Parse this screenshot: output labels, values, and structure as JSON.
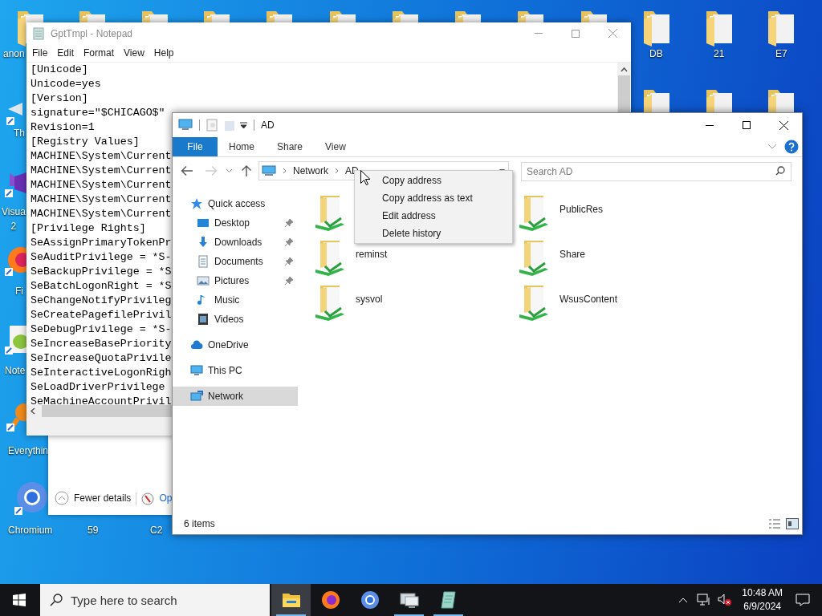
{
  "desktop": {
    "icons": [
      {
        "kind": "folder",
        "label": "anon"
      },
      {
        "kind": "folder"
      },
      {
        "kind": "folder"
      },
      {
        "kind": "folder"
      },
      {
        "kind": "folder"
      },
      {
        "kind": "folder"
      },
      {
        "kind": "folder"
      },
      {
        "kind": "folder"
      },
      {
        "kind": "folder"
      },
      {
        "kind": "folder"
      },
      {
        "kind": "folder",
        "label": "DB"
      },
      {
        "kind": "folder",
        "label": "21"
      },
      {
        "kind": "folder",
        "label": "E7"
      },
      {
        "kind": "folder"
      },
      {
        "kind": "folder"
      },
      {
        "kind": "folder"
      },
      {
        "kind": "app",
        "label": "Th"
      },
      {
        "kind": "visualstudio",
        "label": "Visua\n2"
      },
      {
        "kind": "firefox",
        "label": "Fi"
      },
      {
        "kind": "notepadpp",
        "label": "Note"
      },
      {
        "kind": "everything",
        "label": "Everythin"
      },
      {
        "kind": "chromium",
        "label": "Chromium"
      },
      {
        "kind": "covered",
        "label": "59"
      },
      {
        "kind": "covered",
        "label": "C2"
      }
    ]
  },
  "background_dialog": {
    "toggle": "Fewer details",
    "link": "Op"
  },
  "notepad": {
    "title": "GptTmpl - Notepad",
    "menu": [
      "File",
      "Edit",
      "Format",
      "View",
      "Help"
    ],
    "lines": [
      "[Unicode]",
      "Unicode=yes",
      "[Version]",
      "signature=\"$CHICAGO$\"",
      "Revision=1",
      "[Registry Values]",
      "MACHINE\\System\\Current",
      "MACHINE\\System\\Current",
      "MACHINE\\System\\Current",
      "MACHINE\\System\\Current",
      "MACHINE\\System\\Current",
      "[Privilege Rights]",
      "SeAssignPrimaryTokenPr",
      "SeAuditPrivilege = *S-",
      "SeBackupPrivilege = *S",
      "SeBatchLogonRight = *S",
      "SeChangeNotifyPrivileg",
      "SeCreatePagefilePrivil",
      "SeDebugPrivilege = *S-",
      "SeIncreaseBasePriority",
      "SeIncreaseQuotaPrivile",
      "SeInteractiveLogonRigh",
      "SeLoadDriverPrivilege",
      "SeMachineAccountPrivil"
    ]
  },
  "explorer": {
    "title": "AD",
    "ribbon_tabs": [
      {
        "label": "File",
        "kind": "menu"
      },
      {
        "label": "Home",
        "kind": "tab"
      },
      {
        "label": "Share",
        "kind": "tab"
      },
      {
        "label": "View",
        "kind": "tab"
      }
    ],
    "address": [
      "Network",
      "AD"
    ],
    "search": {
      "placeholder": "Search AD"
    },
    "nav": [
      {
        "label": "Quick access",
        "kind": "star",
        "selected": false,
        "children": [
          {
            "label": "Desktop",
            "kind": "desktop",
            "pinned": true,
            "selected": false
          },
          {
            "label": "Downloads",
            "kind": "download",
            "pinned": true,
            "selected": false
          },
          {
            "label": "Documents",
            "kind": "document",
            "pinned": true,
            "selected": false
          },
          {
            "label": "Pictures",
            "kind": "picture",
            "pinned": true,
            "selected": false
          },
          {
            "label": "Music",
            "kind": "music",
            "pinned": false,
            "selected": false
          },
          {
            "label": "Videos",
            "kind": "video",
            "pinned": false,
            "selected": false
          }
        ]
      },
      {
        "label": "OneDrive",
        "kind": "cloud",
        "selected": false
      },
      {
        "label": "This PC",
        "kind": "computer",
        "selected": false
      },
      {
        "label": "Network",
        "kind": "network",
        "selected": true
      }
    ],
    "items": [
      {
        "kind": "share"
      },
      {
        "kind": "share",
        "name": "PublicRes"
      },
      {
        "kind": "share",
        "name": "reminst"
      },
      {
        "kind": "share",
        "name": "Share"
      },
      {
        "kind": "share",
        "name": "sysvol"
      },
      {
        "kind": "share",
        "name": "WsusContent"
      }
    ],
    "status": "6 items"
  },
  "context_menu": [
    "Copy address",
    "Copy address as text",
    "Edit address",
    "Delete history"
  ],
  "taskbar": {
    "search_placeholder": "Type here to search",
    "apps": [
      {
        "kind": "explorer",
        "active": true,
        "running": true
      },
      {
        "kind": "firefox",
        "active": false,
        "running": false
      },
      {
        "kind": "chromium",
        "active": false,
        "running": false
      },
      {
        "kind": "remote",
        "active": false,
        "running": true
      },
      {
        "kind": "notepad",
        "active": false,
        "running": true
      }
    ],
    "time": "10:48 AM",
    "date": "6/9/2024"
  }
}
